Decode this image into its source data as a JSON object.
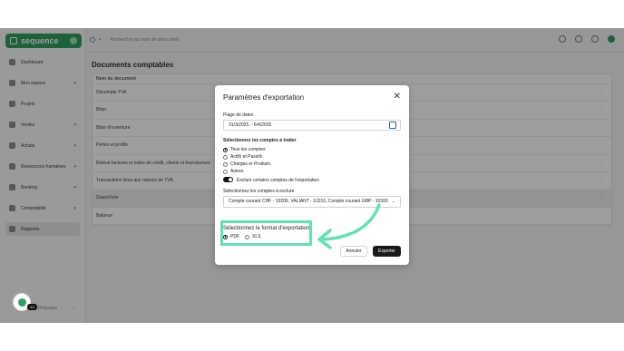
{
  "brand": {
    "name": "sequence"
  },
  "sidebar": {
    "items": [
      {
        "label": "Dashboard",
        "has_chevron": false,
        "active": false
      },
      {
        "label": "Mon espace",
        "has_chevron": true,
        "active": false
      },
      {
        "label": "Projets",
        "has_chevron": false,
        "active": false
      },
      {
        "label": "Ventes",
        "has_chevron": true,
        "active": false
      },
      {
        "label": "Achats",
        "has_chevron": true,
        "active": false
      },
      {
        "label": "Ressources humaines",
        "has_chevron": true,
        "active": false
      },
      {
        "label": "Banking",
        "has_chevron": true,
        "active": false
      },
      {
        "label": "Comptabilité",
        "has_chevron": true,
        "active": false
      },
      {
        "label": "Rapports",
        "has_chevron": false,
        "active": true
      }
    ],
    "bottom_label": "Réglages",
    "chat_badge": "10"
  },
  "topbar": {
    "search_placeholder": "Recherche par nom de dans client"
  },
  "main": {
    "title": "Documents comptables",
    "column_header": "Nom du document",
    "rows": [
      "Décompte TVA",
      "Bilan",
      "Bilan d'ouverture",
      "Pertes et profits",
      "Relevé factures et notes de crédit, clients et fournisseurs",
      "Transactions liées aux relevés de TVA",
      "Grand livre",
      "Balance"
    ]
  },
  "modal": {
    "title": "Paramètres d'exportation",
    "date_range_label": "Plage de dates",
    "date_range_value": "31/3/2025 – 6/4/2025",
    "accounts_label": "Sélectionnez les comptes à traiter",
    "account_options": [
      {
        "label": "Tous les comptes",
        "selected": true
      },
      {
        "label": "Actifs et Passifs",
        "selected": false
      },
      {
        "label": "Charges et Produits",
        "selected": false
      },
      {
        "label": "Autres",
        "selected": false
      }
    ],
    "exclude_toggle_label": "Exclure certains comptes de l'exportation",
    "exclude_select_label": "Sélectionnez les comptes à exclure",
    "exclude_select_value": "Compte courant CHF - 10200, VALIANT - 10210, Compte courant GBP - 10300",
    "format_label": "Sélectionnez le format d'exportation",
    "format_options": [
      {
        "label": "PDF",
        "selected": true
      },
      {
        "label": "XLS",
        "selected": false
      }
    ],
    "cancel_label": "Annuler",
    "export_label": "Exporter"
  },
  "colors": {
    "brand": "#2f9e5e",
    "highlight": "#5fe3b3",
    "primary_button": "#1a1a1a"
  }
}
